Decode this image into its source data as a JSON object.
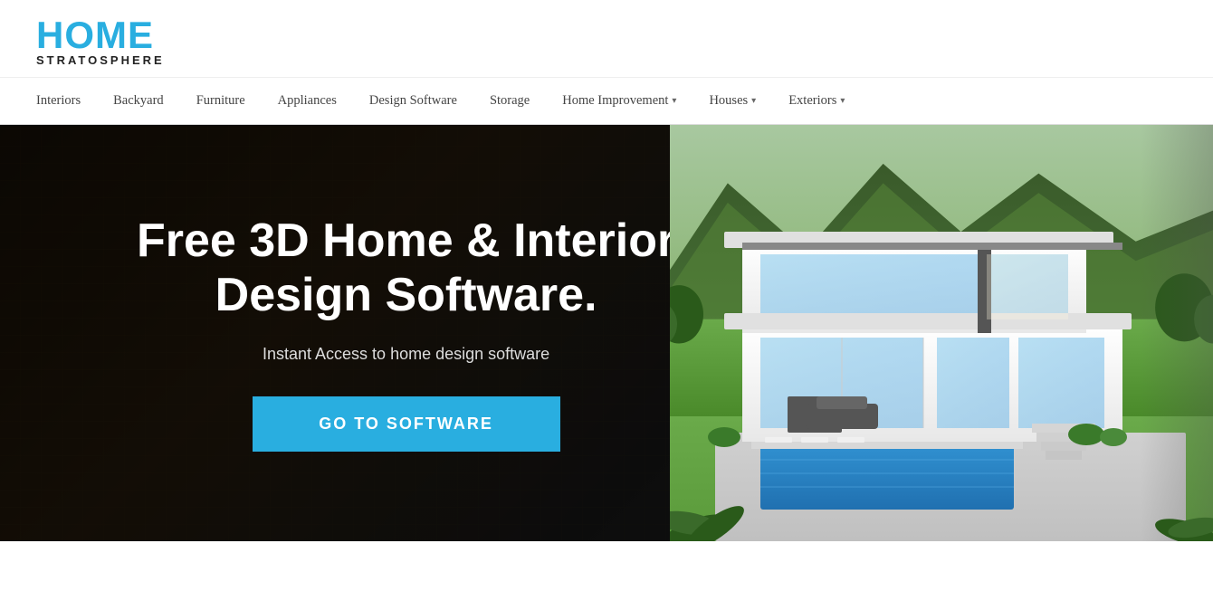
{
  "header": {
    "logo_home": "HOME",
    "logo_stratosphere": "STRATOSPHERE"
  },
  "nav": {
    "items": [
      {
        "label": "Interiors",
        "has_dropdown": false
      },
      {
        "label": "Backyard",
        "has_dropdown": false
      },
      {
        "label": "Furniture",
        "has_dropdown": false
      },
      {
        "label": "Appliances",
        "has_dropdown": false
      },
      {
        "label": "Design Software",
        "has_dropdown": false
      },
      {
        "label": "Storage",
        "has_dropdown": false
      },
      {
        "label": "Home Improvement",
        "has_dropdown": true
      },
      {
        "label": "Houses",
        "has_dropdown": true
      },
      {
        "label": "Exteriors",
        "has_dropdown": true
      }
    ]
  },
  "hero": {
    "title": "Free 3D Home & Interior Design Software.",
    "subtitle": "Instant Access to home design software",
    "button_label": "GO TO SOFTWARE"
  },
  "colors": {
    "brand_blue": "#29aee0",
    "nav_text": "#444444",
    "hero_bg": "#1a1a1a"
  }
}
